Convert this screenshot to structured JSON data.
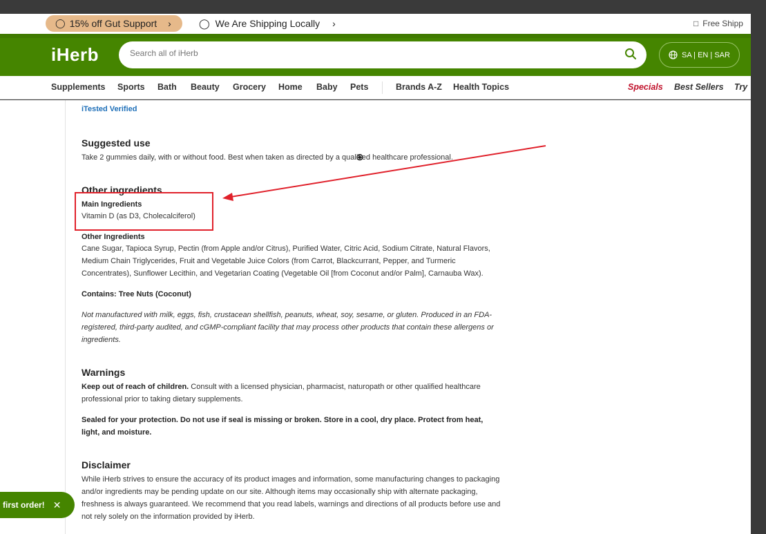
{
  "promo": {
    "discount_label": "15% off Gut Support",
    "shipping_label": "We Are Shipping Locally",
    "free_shipping_label": "Free Shipp"
  },
  "header": {
    "logo_text": "iHerb",
    "search_placeholder": "Search all of iHerb",
    "locale_label": "SA | EN | SAR"
  },
  "nav": {
    "items": [
      "Supplements",
      "Sports",
      "Bath",
      "Beauty",
      "Grocery",
      "Home",
      "Baby",
      "Pets",
      "Brands A-Z",
      "Health Topics",
      "Specials",
      "Best Sellers",
      "Try"
    ]
  },
  "content": {
    "verified_label": "iTested Verified",
    "suggested_use": {
      "heading": "Suggested use",
      "text": "Take 2 gummies daily, with or without food. Best when taken as directed by a qualified healthcare professional."
    },
    "other_ingredients": {
      "heading": "Other ingredients",
      "main_label": "Main Ingredients",
      "main_text": "Vitamin D (as D3, Cholecalciferol)",
      "other_label": "Other Ingredients",
      "other_text": "Cane Sugar, Tapioca Syrup, Pectin (from Apple and/or Citrus), Purified Water, Citric Acid, Sodium Citrate, Natural Flavors, Medium Chain Triglycerides, Fruit and Vegetable Juice Colors (from Carrot, Blackcurrant, Pepper, and Turmeric Concentrates), Sunflower Lecithin, and Vegetarian Coating (Vegetable Oil [from Coconut and/or Palm], Carnauba Wax).",
      "contains": "Contains: Tree Nuts (Coconut)",
      "allergen_note": "Not manufactured with milk, eggs, fish, crustacean shellfish, peanuts, wheat, soy, sesame, or gluten. Produced in an FDA-registered, third-party audited, and cGMP-compliant facility that may process other products that contain these allergens or ingredients."
    },
    "warnings": {
      "heading": "Warnings",
      "lead": "Keep out of reach of children.",
      "text": " Consult with a licensed physician, pharmacist, naturopath or other qualified healthcare professional prior to taking dietary supplements.",
      "sealed": "Sealed for your protection. Do not use if seal is missing or broken. Store in a cool, dry place. Protect from heat, light, and moisture."
    },
    "disclaimer": {
      "heading": "Disclaimer",
      "text": "While iHerb strives to ensure the accuracy of its product images and information, some manufacturing changes to packaging and/or ingredients may be pending update on our site. Although items may occasionally ship with alternate packaging, freshness is always guaranteed. We recommend that you read labels, warnings and directions of all products before use and not rely solely on the information provided by iHerb."
    }
  },
  "toast": {
    "text": "first order!"
  },
  "colors": {
    "brand_green": "#458500",
    "promo_pill": "#e6b98a",
    "annotation_red": "#e0202a",
    "specials_red": "#c0112b",
    "link_blue": "#1e6fb8"
  }
}
